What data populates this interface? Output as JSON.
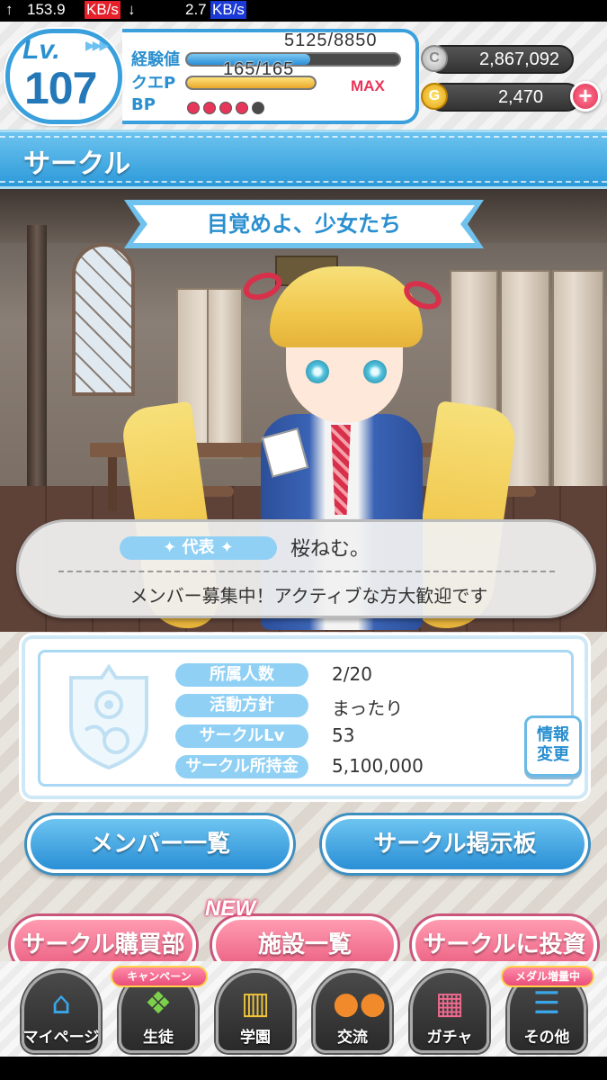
{
  "status_bar": {
    "up_arrow": "↑",
    "up_speed_value": "153.9",
    "up_speed_unit": "KB/s",
    "down_arrow": "↓",
    "down_speed_value": "2.7",
    "down_speed_unit": "KB/s"
  },
  "player": {
    "level_label": "Lv.",
    "level": "107",
    "exp_label": "経験値",
    "exp_text": "5125/8850",
    "exp_fraction": 0.579,
    "quest_label": "クエP",
    "quest_text": "165/165",
    "quest_fraction": 1.0,
    "max_label": "MAX",
    "bp_label": "BP",
    "bp_filled": 4,
    "bp_total": 5
  },
  "currency": {
    "coin_symbol": "C",
    "coins": "2,867,092",
    "gem_symbol": "G",
    "gems": "2,470",
    "add_symbol": "+"
  },
  "page": {
    "title": "サークル",
    "motto": "目覚めよ、少女たち"
  },
  "leader": {
    "badge_label": "代表",
    "name": "桜ねむ。",
    "message": "メンバー募集中！アクティブな方大歓迎です"
  },
  "circle_info": {
    "rows": [
      {
        "label": "所属人数",
        "value": "2/20"
      },
      {
        "label": "活動方針",
        "value": "まったり"
      },
      {
        "label": "サークルLv",
        "value": "53"
      },
      {
        "label": "サークル所持金",
        "value": "5,100,000"
      }
    ],
    "edit_line1": "情報",
    "edit_line2": "変更"
  },
  "actions": {
    "member_list": "メンバー一覧",
    "bulletin_board": "サークル掲示板",
    "shop": "サークル購買部",
    "facilities": "施設一覧",
    "invest": "サークルに投資",
    "new_badge": "NEW"
  },
  "nav": {
    "items": [
      {
        "label": "マイページ",
        "icon": "house-icon",
        "tag": ""
      },
      {
        "label": "生徒",
        "icon": "cards-icon",
        "tag": "キャンペーン"
      },
      {
        "label": "学園",
        "icon": "gate-icon",
        "tag": ""
      },
      {
        "label": "交流",
        "icon": "people-icon",
        "tag": ""
      },
      {
        "label": "ガチャ",
        "icon": "building-icon",
        "tag": ""
      },
      {
        "label": "その他",
        "icon": "menu-icon",
        "tag": "メダル増量中"
      }
    ]
  },
  "colors": {
    "accent_blue": "#2a8fd0",
    "accent_pink": "#e94e7a",
    "exp_bar": "#3a9fdd",
    "quest_bar": "#f2c43a",
    "bp_active": "#e8365a"
  }
}
